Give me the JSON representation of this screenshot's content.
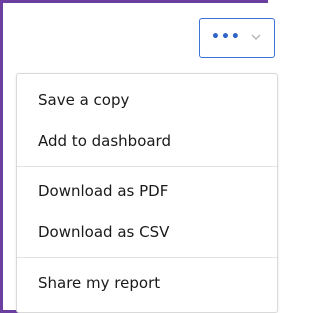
{
  "toolbar": {
    "more_button_glyph": "•••"
  },
  "menu": {
    "items": [
      {
        "label": "Save a copy"
      },
      {
        "label": "Add to dashboard"
      },
      {
        "label": "Download as PDF"
      },
      {
        "label": "Download as CSV"
      },
      {
        "label": "Share my report"
      }
    ]
  },
  "colors": {
    "frame_border": "#6b3fa0",
    "button_border": "#3a74d6",
    "button_icon": "#2f63c8",
    "menu_text": "#1a1a1a",
    "divider": "#e3e3e3"
  }
}
